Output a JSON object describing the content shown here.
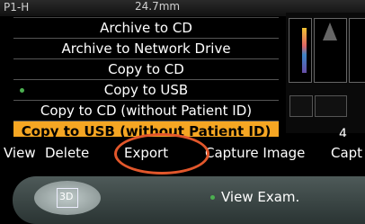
{
  "header": {
    "left_text": "P1-H",
    "center_text": "24.7mm"
  },
  "right_panel": {
    "page_number": "4"
  },
  "export_menu": {
    "items": [
      {
        "label": "Archive to CD",
        "marked": false,
        "selected": false
      },
      {
        "label": "Archive to Network Drive",
        "marked": false,
        "selected": false
      },
      {
        "label": "Copy to CD",
        "marked": false,
        "selected": false
      },
      {
        "label": "Copy to USB",
        "marked": true,
        "selected": false
      },
      {
        "label": "Copy to CD (without Patient ID)",
        "marked": false,
        "selected": false
      },
      {
        "label": "Copy to USB (without Patient ID)",
        "marked": false,
        "selected": true
      }
    ]
  },
  "action_bar": {
    "items": [
      "View",
      "Delete",
      "Export",
      "Capture Image",
      "Capt"
    ],
    "highlighted": "Export",
    "highlight_color": "#e2572b"
  },
  "bottom_panel": {
    "button_3d_label": "3D",
    "view_exam_label": "View Exam."
  },
  "colors": {
    "selected_item_bg": "#f5a623",
    "marker_dot": "#4caf50"
  }
}
